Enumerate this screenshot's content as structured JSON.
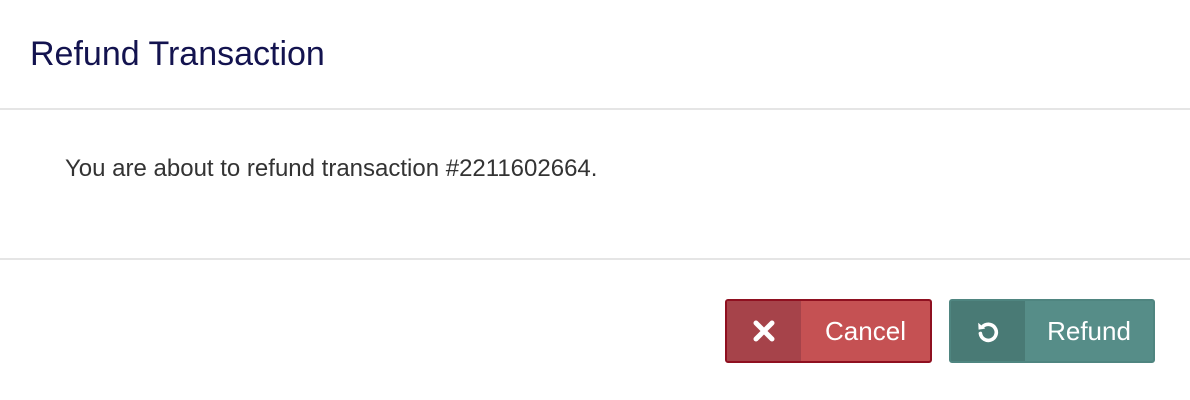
{
  "dialog": {
    "title": "Refund Transaction",
    "message": "You are about to refund transaction #2211602664."
  },
  "buttons": {
    "cancel": {
      "label": "Cancel",
      "icon": "close-icon",
      "color": "#c55153",
      "icon_bg": "#a6434a"
    },
    "refund": {
      "label": "Refund",
      "icon": "undo-icon",
      "color": "#568d88",
      "icon_bg": "#497a75"
    }
  },
  "colors": {
    "title": "#13134f",
    "text": "#333333",
    "divider": "#e5e5e5"
  }
}
